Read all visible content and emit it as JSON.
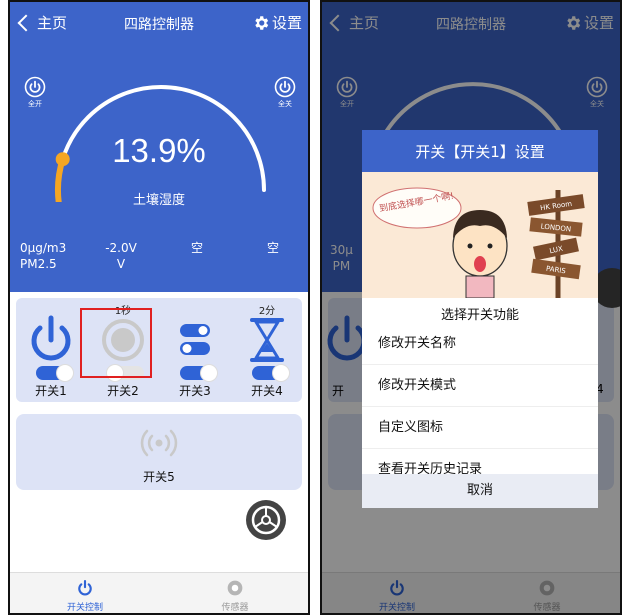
{
  "screens": {
    "left": {
      "nav": {
        "back_label": "主页",
        "title": "四路控制器",
        "settings_label": "设置"
      },
      "all_on_label": "全开",
      "all_off_label": "全关",
      "humidity": {
        "value": "13.9%",
        "label": "土壤湿度",
        "fraction": 0.139
      },
      "sensors": [
        {
          "value": "0μg/m3",
          "name": "PM2.5"
        },
        {
          "value": "-2.0V",
          "name": "V"
        },
        {
          "value": "空",
          "name": ""
        },
        {
          "value": "空",
          "name": ""
        }
      ],
      "switches": [
        {
          "label": "开关1",
          "timer": "",
          "state": "on",
          "icon": "power-icon"
        },
        {
          "label": "开关2",
          "timer": "1秒",
          "state": "off",
          "icon": "round-button-icon"
        },
        {
          "label": "开关3",
          "timer": "",
          "state": "on",
          "icon": "toggle-stack-icon"
        },
        {
          "label": "开关4",
          "timer": "2分",
          "state": "on",
          "icon": "hourglass-icon"
        }
      ],
      "switch5_label": "开关5",
      "tabs": {
        "control": "开关控制",
        "sensor": "传感器"
      }
    },
    "right": {
      "nav": {
        "back_label": "主页",
        "title": "四路控制器",
        "settings_label": "设置"
      },
      "all_on_label": "全开",
      "all_off_label": "全关",
      "partial": {
        "sensor_value": "30μ",
        "sensor_name": "PM",
        "switch_num": "4",
        "switch_prefix": "开"
      },
      "dialog": {
        "title": "开关【开关1】设置",
        "subtitle": "选择开关功能",
        "options": [
          "修改开关名称",
          "修改开关模式",
          "自定义图标",
          "查看开关历史记录"
        ],
        "cancel": "取消",
        "art_bubble": "到底选择哪一个啊!",
        "art_signs": [
          "HK Room",
          "LONDON",
          "LUX",
          "PARIS"
        ]
      },
      "tabs": {
        "control": "开关控制",
        "sensor": "传感器"
      }
    }
  },
  "colors": {
    "header_blue": "#3d64c9",
    "accent_blue": "#2f63d6",
    "gauge_orange": "#f5a623",
    "panel_bg": "#dde3f6",
    "highlight_red": "#e02020"
  }
}
